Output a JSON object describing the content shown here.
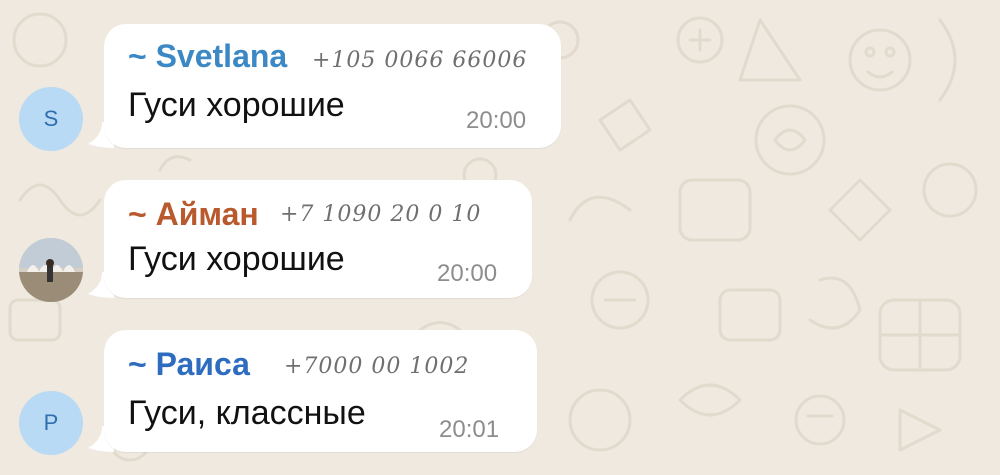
{
  "chat": {
    "messages": [
      {
        "sender": "~ Svetlana",
        "sender_color": "#3b88c4",
        "phone": "+105 0066 66006",
        "text": "Гуси хорошие",
        "time": "20:00",
        "avatar_letter": "S",
        "avatar_type": "letter"
      },
      {
        "sender": "~ Айман",
        "sender_color": "#b95a2e",
        "phone": "+7 1090 20 0 10",
        "text": "Гуси хорошие",
        "time": "20:00",
        "avatar_type": "photo"
      },
      {
        "sender": "~ Раиса",
        "sender_color": "#2e6cc0",
        "phone": "+7000 00 1002",
        "text": "Гуси, классные",
        "time": "20:01",
        "avatar_letter": "P",
        "avatar_type": "letter"
      }
    ]
  },
  "colors": {
    "wallpaper": "#efe9df",
    "bubble": "#ffffff",
    "timestamp": "#8d8d8d"
  }
}
